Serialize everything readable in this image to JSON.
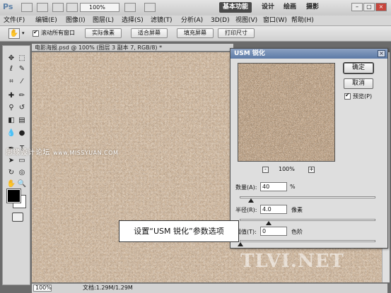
{
  "app": {
    "logo": "Ps",
    "zoom_select": "100%",
    "workspaces": [
      "基本功能",
      "设计",
      "绘画",
      "摄影"
    ],
    "window_controls": [
      "–",
      "▢",
      "×"
    ]
  },
  "menu": [
    "文件(F)",
    "编辑(E)",
    "图像(I)",
    "图层(L)",
    "选择(S)",
    "滤镜(T)",
    "分析(A)",
    "3D(D)",
    "视图(V)",
    "窗口(W)",
    "帮助(H)"
  ],
  "options": {
    "scroll_all_label": "滚动所有窗口",
    "scroll_all_checked": true,
    "buttons": [
      "实际像素",
      "适合屏幕",
      "填充屏幕",
      "打印尺寸"
    ]
  },
  "document": {
    "tab_title": "电影海报.psd @ 100% (图层 3 副本 7, RGB/8) *",
    "status_zoom": "100%",
    "status_doc": "文档:1.29M/1.29M"
  },
  "watermarks": {
    "left": "思缘设计论坛",
    "left_url": "www.MISSYUAN.COM",
    "bottom_right": "TLVI.NET"
  },
  "callout": "设置“USM 锐化”参数选项",
  "dialog": {
    "title": "USM 锐化",
    "ok": "确定",
    "cancel": "取消",
    "preview_label": "预览(P)",
    "preview_checked": true,
    "zoom_minus": "-",
    "zoom_plus": "+",
    "zoom": "100%",
    "amount": {
      "label": "数量(A):",
      "value": "40",
      "unit": "%",
      "slider": 0.08
    },
    "radius": {
      "label": "半径(R):",
      "value": "4.0",
      "unit": "像素",
      "slider": 0.21
    },
    "threshold": {
      "label": "阈值(T):",
      "value": "0",
      "unit": "色阶",
      "slider": 0.0
    }
  }
}
